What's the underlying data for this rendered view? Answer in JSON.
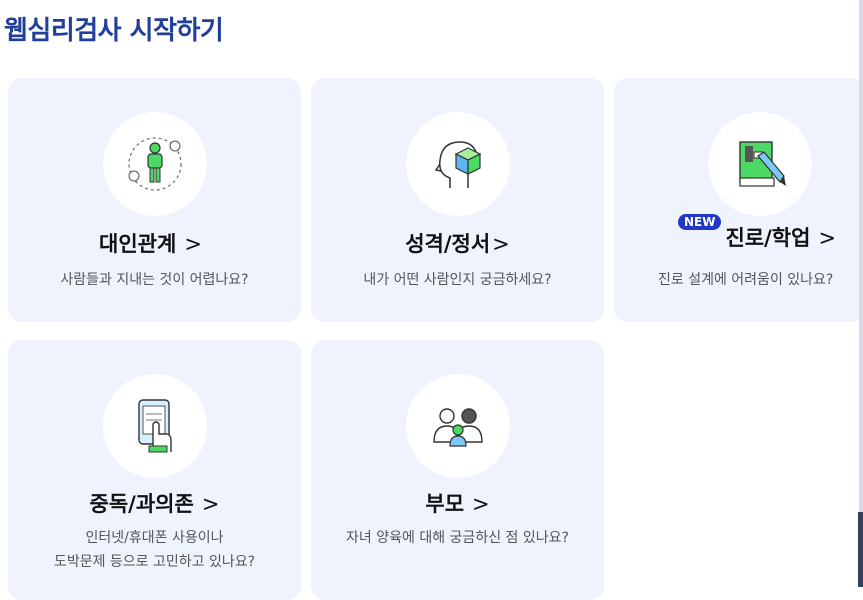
{
  "page": {
    "title": "웹심리검사 시작하기"
  },
  "cards": [
    {
      "title": "대인관계",
      "chevron": ">",
      "desc": "사람들과 지내는 것이 어렵나요?"
    },
    {
      "title": "성격/정서",
      "chevron": ">",
      "desc": "내가 어떤 사람인지 궁금하세요?"
    },
    {
      "title": "진로/학업",
      "chevron": ">",
      "desc": "진로 설계에 어려움이 있나요?",
      "badge": "NEW"
    },
    {
      "title": "중독/과의존",
      "chevron": ">",
      "desc_lines": [
        "인터넷/휴대폰 사용이나",
        "도박문제 등으로 고민하고 있나요?"
      ]
    },
    {
      "title": "부모",
      "chevron": ">",
      "desc": "자녀 양육에 대해 궁금하신 점 있나요?"
    }
  ],
  "colors": {
    "title": "#1f3f9b",
    "card_bg": "#eef3fd",
    "accent_green": "#4cd964",
    "badge": "#2338c9"
  },
  "icons": [
    "person-orbit-icon",
    "head-cube-icon",
    "book-pencil-icon",
    "phone-touch-icon",
    "family-icon"
  ]
}
